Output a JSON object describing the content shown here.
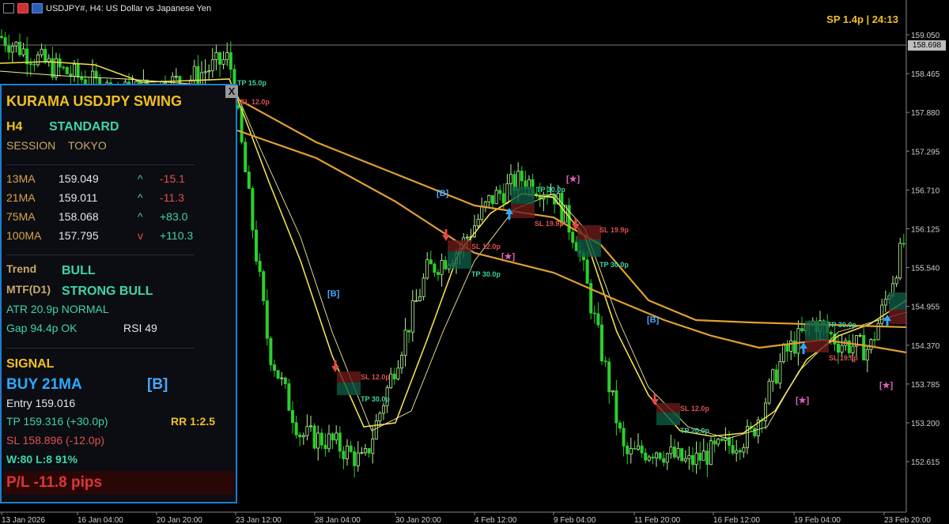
{
  "title_bar": {
    "symbol": "USDJPY#, H4:  US Dollar vs Japanese Yen"
  },
  "header_right": {
    "spread": "SP 1.4p  |  24:13"
  },
  "price_axis": {
    "labels": [
      "159.050",
      "158.465",
      "157.880",
      "157.295",
      "156.710",
      "156.125",
      "155.540",
      "154.955",
      "154.370",
      "153.785",
      "153.200",
      "152.615"
    ],
    "current_price": "158.698"
  },
  "time_axis": {
    "labels": [
      "13 Jan 2026",
      "16 Jan 04:00",
      "20 Jan 20:00",
      "23 Jan 12:00",
      "28 Jan 04:00",
      "30 Jan 20:00",
      "4 Feb 12:00",
      "9 Feb 04:00",
      "11 Feb 20:00",
      "16 Feb 12:00",
      "19 Feb 04:00",
      "23 Feb 20:00"
    ]
  },
  "panel": {
    "title": "KURAMA USDJPY SWING",
    "timeframe": "H4",
    "mode": "STANDARD",
    "session_label": "SESSION",
    "session_value": "TOKYO",
    "ma_rows": [
      {
        "name": "13MA",
        "value": "159.049",
        "arrow": "^",
        "change": "-15.1",
        "arrow_color": "#3fd5a8",
        "change_color": "#e05050"
      },
      {
        "name": "21MA",
        "value": "159.011",
        "arrow": "^",
        "change": "-11.3",
        "arrow_color": "#3fd5a8",
        "change_color": "#e05050"
      },
      {
        "name": "75MA",
        "value": "158.068",
        "arrow": "^",
        "change": "+83.0",
        "arrow_color": "#3fd5a8",
        "change_color": "#3fd5a8"
      },
      {
        "name": "100MA",
        "value": "157.795",
        "arrow": "v",
        "change": "+110.3",
        "arrow_color": "#e05050",
        "change_color": "#3fd5a8"
      }
    ],
    "trend_label": "Trend",
    "trend_value": "BULL",
    "mtf_label": "MTF(D1)",
    "mtf_value": "STRONG BULL",
    "atr": "ATR  20.9p  NORMAL",
    "gap": "Gap 94.4p OK",
    "rsi": "RSI 49",
    "signal_label": "SIGNAL",
    "signal_value": "BUY  21MA",
    "signal_tag": "[B]",
    "entry": "Entry  159.016",
    "tp": "TP  159.316  (+30.0p)",
    "rr": "RR 1:2.5",
    "sl": "SL  158.896  (-12.0p)",
    "winloss": "W:80 L:8  91%",
    "pl": "P/L  -11.8 pips",
    "close": "X"
  },
  "chart_data": {
    "type": "candlestick",
    "ylim": [
      152.3,
      159.3
    ],
    "annotations": [
      {
        "text": "TP 15.0p",
        "color": "#3fd5a8"
      },
      {
        "text": "SL 12.0p",
        "color": "#e05050"
      },
      {
        "text": "[B]",
        "color": "#4aa8ff"
      },
      {
        "text": "SL 12.0p",
        "color": "#e05050"
      },
      {
        "text": "TP 30.0p",
        "color": "#3fd5a8"
      },
      {
        "text": "[B]",
        "color": "#4aa8ff"
      },
      {
        "text": "SL 12.0p",
        "color": "#e05050"
      },
      {
        "text": "TP 30.0p",
        "color": "#3fd5a8"
      },
      {
        "text": "[★]",
        "color": "#e060c0"
      },
      {
        "text": "TP 30.0p",
        "color": "#3fd5a8"
      },
      {
        "text": "SL 19.9p",
        "color": "#e05050"
      },
      {
        "text": "[★]",
        "color": "#e060c0"
      },
      {
        "text": "SL 19.9p",
        "color": "#e05050"
      },
      {
        "text": "TP 30.0p",
        "color": "#3fd5a8"
      },
      {
        "text": "[B]",
        "color": "#4aa8ff"
      },
      {
        "text": "SL 12.0p",
        "color": "#e05050"
      },
      {
        "text": "TP 20.0p",
        "color": "#3fd5a8"
      },
      {
        "text": "TP 30.0p",
        "color": "#3fd5a8"
      },
      {
        "text": "SL 19.9p",
        "color": "#e05050"
      },
      {
        "text": "[★]",
        "color": "#e060c0"
      },
      {
        "text": "[★]",
        "color": "#e060c0"
      }
    ],
    "colors": {
      "bull": "#b8f59a",
      "bear": "#2bd02b",
      "ma_fast": "#f2e14a",
      "ma_slow": "#e0a030",
      "ma_thin": "#f5f0a0"
    }
  }
}
